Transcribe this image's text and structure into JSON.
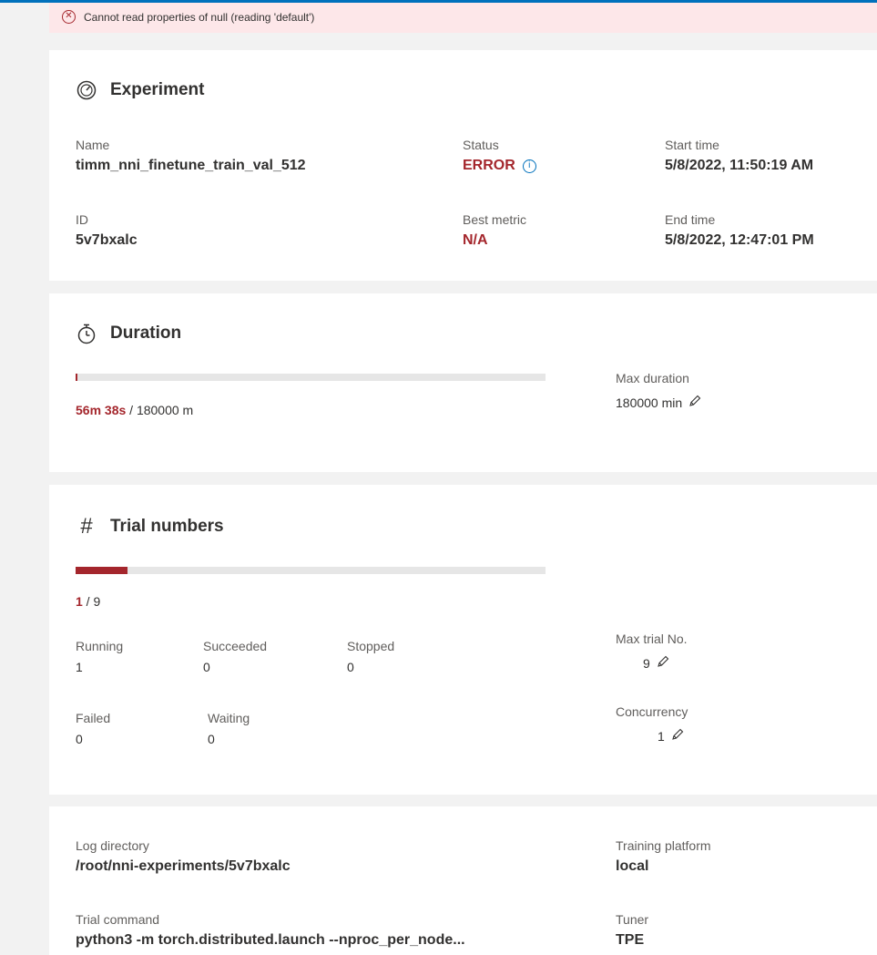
{
  "error": {
    "message": "Cannot read properties of null (reading 'default')"
  },
  "experiment": {
    "title": "Experiment",
    "name_label": "Name",
    "name": "timm_nni_finetune_train_val_512",
    "status_label": "Status",
    "status": "ERROR",
    "start_label": "Start time",
    "start": "5/8/2022, 11:50:19 AM",
    "id_label": "ID",
    "id": "5v7bxalc",
    "best_label": "Best metric",
    "best": "N/A",
    "end_label": "End time",
    "end": "5/8/2022, 12:47:01 PM"
  },
  "duration": {
    "title": "Duration",
    "elapsed": "56m 38s",
    "total": " / 180000 m",
    "progress_fraction": 0.0003,
    "max_label": "Max duration",
    "max_value": "180000 min"
  },
  "trials": {
    "title": "Trial numbers",
    "done": "1",
    "total": " / 9",
    "progress_fraction": 0.111,
    "running_label": "Running",
    "running": "1",
    "succeeded_label": "Succeeded",
    "succeeded": "0",
    "stopped_label": "Stopped",
    "stopped": "0",
    "failed_label": "Failed",
    "failed": "0",
    "waiting_label": "Waiting",
    "waiting": "0",
    "max_label": "Max trial No.",
    "max_value": "9",
    "concurrency_label": "Concurrency",
    "concurrency_value": "1"
  },
  "info": {
    "logdir_label": "Log directory",
    "logdir": "/root/nni-experiments/5v7bxalc",
    "platform_label": "Training platform",
    "platform": "local",
    "command_label": "Trial command",
    "command": "python3 -m torch.distributed.launch --nproc_per_node...",
    "tuner_label": "Tuner",
    "tuner": "TPE"
  },
  "colors": {
    "error": "#a4262c",
    "accent": "#0071bc",
    "track": "#e6e6e6"
  },
  "icons": {
    "experiment": "gauge-icon",
    "duration": "stopwatch-icon",
    "trials": "hash-icon",
    "edit": "pencil-icon",
    "info": "info-icon",
    "error": "error-circle-icon"
  }
}
